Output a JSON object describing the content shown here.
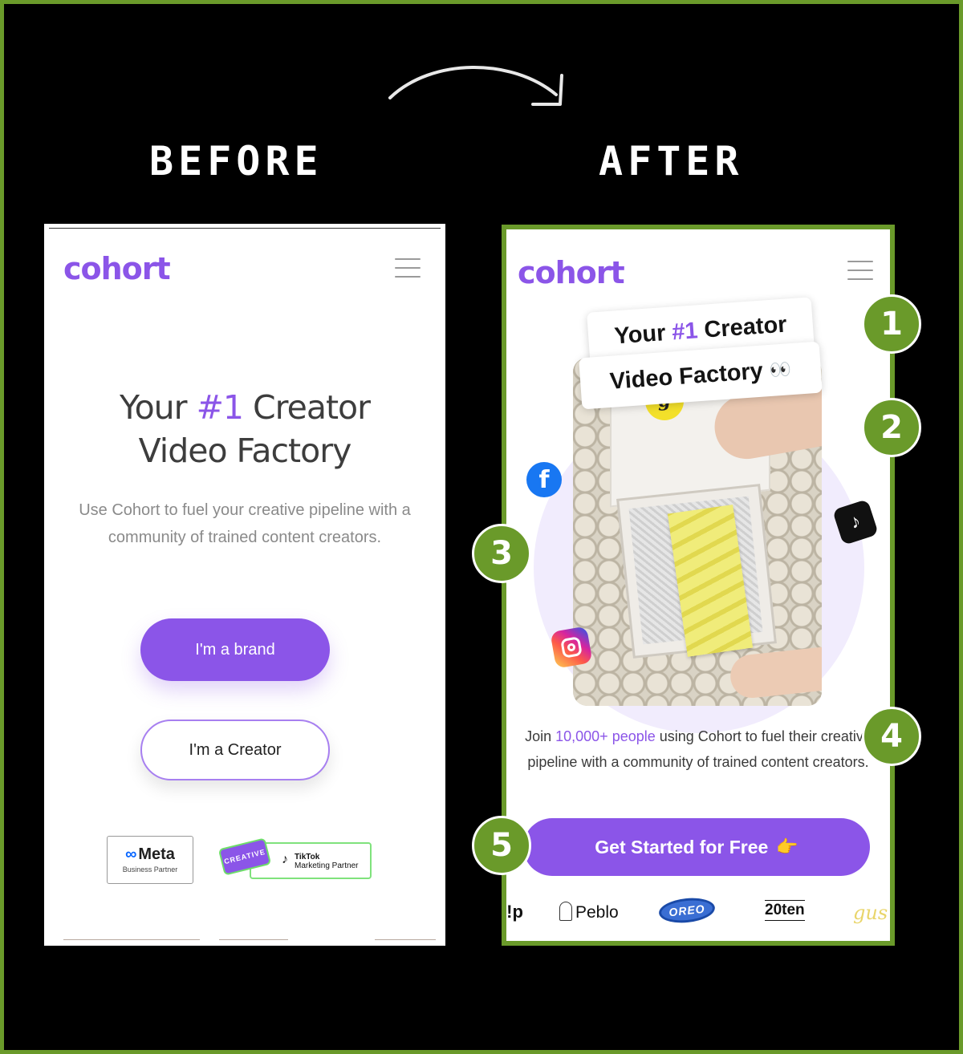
{
  "labels": {
    "before": "BEFORE",
    "after": "AFTER"
  },
  "before": {
    "logo": "cohort",
    "title_pre": "Your ",
    "title_hl": "#1",
    "title_post": " Creator",
    "title_line2": "Video Factory",
    "subtitle": "Use Cohort to fuel your creative pipeline with a community of trained content creators.",
    "brand_button": "I'm a brand",
    "creator_button": "I'm a Creator",
    "meta_badge": {
      "name": "Meta",
      "subtitle": "Business Partner"
    },
    "tiktok_badge": {
      "tag": "CREATIVE",
      "name": "TikTok",
      "subtitle": "Marketing Partner"
    }
  },
  "after": {
    "logo": "cohort",
    "tag_line1_pre": "Your",
    "tag_line1_hl": "#1",
    "tag_line1_post": "Creator",
    "tag_line2": "Video Factory",
    "tag_emoji": "👀",
    "photo_sticker": "g",
    "subtitle_pre": "Join ",
    "subtitle_hl": "10,000+ people",
    "subtitle_post": " using Cohort to fuel their creative pipeline with a community of trained content creators.",
    "cta": "Get Started for Free",
    "cta_emoji": "👉",
    "social_icons": [
      "facebook-icon",
      "tiktok-icon",
      "instagram-icon"
    ],
    "facebook_glyph": "f",
    "tiktok_glyph": "♪",
    "brand_logos": [
      "l!p",
      "Peblo",
      "OREO",
      "20ten",
      "gus"
    ]
  },
  "callouts": [
    "1",
    "2",
    "3",
    "4",
    "5"
  ],
  "colors": {
    "accent": "#8b55e8",
    "callout": "#6a9a2a",
    "background": "#000000"
  }
}
